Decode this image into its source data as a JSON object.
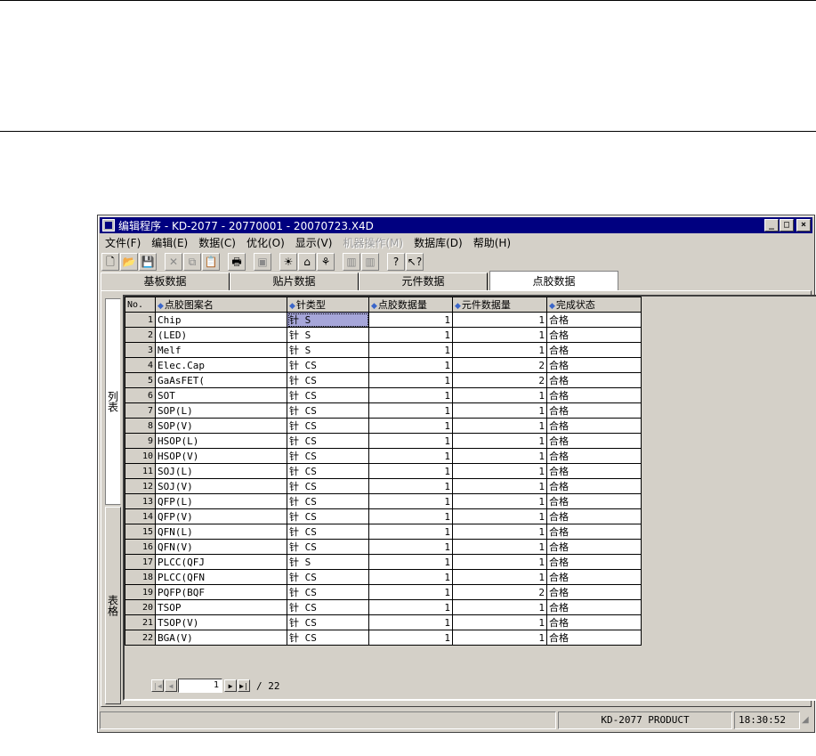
{
  "window": {
    "title": "编辑程序 - KD-2077 - 20770001 - 20070723.X4D",
    "minimize_glyph": "_",
    "maximize_glyph": "□",
    "close_glyph": "×"
  },
  "menu": [
    "文件(F)",
    "编辑(E)",
    "数据(C)",
    "优化(O)",
    "显示(V)",
    "机器操作(M)",
    "数据库(D)",
    "帮助(H)"
  ],
  "menu_disabled_index": 5,
  "toolbar": [
    {
      "icon": "new-file-icon",
      "glyph": "🗋"
    },
    {
      "icon": "open-folder-icon",
      "glyph": "📂"
    },
    {
      "icon": "save-icon",
      "glyph": "💾"
    },
    {
      "icon": "delete-icon",
      "glyph": "✕",
      "disabled": true
    },
    {
      "icon": "copy-icon",
      "glyph": "⧉",
      "disabled": true
    },
    {
      "icon": "paste-icon",
      "glyph": "📋"
    },
    {
      "icon": "print-icon",
      "glyph": "🖶"
    },
    {
      "icon": "find-icon",
      "glyph": "▣",
      "disabled": true
    },
    {
      "icon": "light-icon",
      "glyph": "☀"
    },
    {
      "icon": "align-icon",
      "glyph": "⌂"
    },
    {
      "icon": "optimize-icon",
      "glyph": "⚘"
    },
    {
      "icon": "run-icon",
      "glyph": "▥",
      "disabled": true
    },
    {
      "icon": "stop-icon",
      "glyph": "▥",
      "disabled": true
    },
    {
      "icon": "help-icon",
      "glyph": "?"
    },
    {
      "icon": "context-help-icon",
      "glyph": "↖?"
    }
  ],
  "tabs": [
    "基板数据",
    "贴片数据",
    "元件数据",
    "点胶数据"
  ],
  "active_tab": 3,
  "side_tabs": {
    "list": "列表",
    "table": "表格"
  },
  "columns": {
    "no": "No.",
    "pattern": "点胶图案名",
    "needle": "针类型",
    "dispense_count": "点胶数据量",
    "part_count": "元件数据量",
    "status": "完成状态"
  },
  "rows": [
    {
      "no": "1",
      "pattern": "Chip",
      "needle": "针 S",
      "dispense": "1",
      "parts": "1",
      "status": "合格"
    },
    {
      "no": "2",
      "pattern": "(LED)",
      "needle": "针 S",
      "dispense": "1",
      "parts": "1",
      "status": "合格"
    },
    {
      "no": "3",
      "pattern": "Melf",
      "needle": "针 S",
      "dispense": "1",
      "parts": "1",
      "status": "合格"
    },
    {
      "no": "4",
      "pattern": "Elec.Cap",
      "needle": "针 CS",
      "dispense": "1",
      "parts": "2",
      "status": "合格"
    },
    {
      "no": "5",
      "pattern": "GaAsFET(",
      "needle": "针 CS",
      "dispense": "1",
      "parts": "2",
      "status": "合格"
    },
    {
      "no": "6",
      "pattern": "SOT",
      "needle": "针 CS",
      "dispense": "1",
      "parts": "1",
      "status": "合格"
    },
    {
      "no": "7",
      "pattern": "SOP(L)",
      "needle": "针 CS",
      "dispense": "1",
      "parts": "1",
      "status": "合格"
    },
    {
      "no": "8",
      "pattern": "SOP(V)",
      "needle": "针 CS",
      "dispense": "1",
      "parts": "1",
      "status": "合格"
    },
    {
      "no": "9",
      "pattern": "HSOP(L)",
      "needle": "针 CS",
      "dispense": "1",
      "parts": "1",
      "status": "合格"
    },
    {
      "no": "10",
      "pattern": "HSOP(V)",
      "needle": "针 CS",
      "dispense": "1",
      "parts": "1",
      "status": "合格"
    },
    {
      "no": "11",
      "pattern": "SOJ(L)",
      "needle": "针 CS",
      "dispense": "1",
      "parts": "1",
      "status": "合格"
    },
    {
      "no": "12",
      "pattern": "SOJ(V)",
      "needle": "针 CS",
      "dispense": "1",
      "parts": "1",
      "status": "合格"
    },
    {
      "no": "13",
      "pattern": "QFP(L)",
      "needle": "针 CS",
      "dispense": "1",
      "parts": "1",
      "status": "合格"
    },
    {
      "no": "14",
      "pattern": "QFP(V)",
      "needle": "针 CS",
      "dispense": "1",
      "parts": "1",
      "status": "合格"
    },
    {
      "no": "15",
      "pattern": "QFN(L)",
      "needle": "针 CS",
      "dispense": "1",
      "parts": "1",
      "status": "合格"
    },
    {
      "no": "16",
      "pattern": "QFN(V)",
      "needle": "针 CS",
      "dispense": "1",
      "parts": "1",
      "status": "合格"
    },
    {
      "no": "17",
      "pattern": "PLCC(QFJ",
      "needle": "针 S",
      "dispense": "1",
      "parts": "1",
      "status": "合格"
    },
    {
      "no": "18",
      "pattern": "PLCC(QFN",
      "needle": "针 CS",
      "dispense": "1",
      "parts": "1",
      "status": "合格"
    },
    {
      "no": "19",
      "pattern": "PQFP(BQF",
      "needle": "针 CS",
      "dispense": "1",
      "parts": "2",
      "status": "合格"
    },
    {
      "no": "20",
      "pattern": "TSOP",
      "needle": "针 CS",
      "dispense": "1",
      "parts": "1",
      "status": "合格"
    },
    {
      "no": "21",
      "pattern": "TSOP(V)",
      "needle": "针 CS",
      "dispense": "1",
      "parts": "1",
      "status": "合格"
    },
    {
      "no": "22",
      "pattern": "BGA(V)",
      "needle": "针 CS",
      "dispense": "1",
      "parts": "1",
      "status": "合格"
    }
  ],
  "selected_cell": {
    "row": 0,
    "column": "needle"
  },
  "navigator": {
    "current": "1",
    "total": "/ 22"
  },
  "statusbar": {
    "main": "",
    "product": "KD-2077 PRODUCT",
    "time": "18:30:52"
  },
  "colors": {
    "titlebar": "#000080",
    "face": "#d4d0c8",
    "selection": "#a6a6d9",
    "sort_arrow": "#3b66c9"
  }
}
